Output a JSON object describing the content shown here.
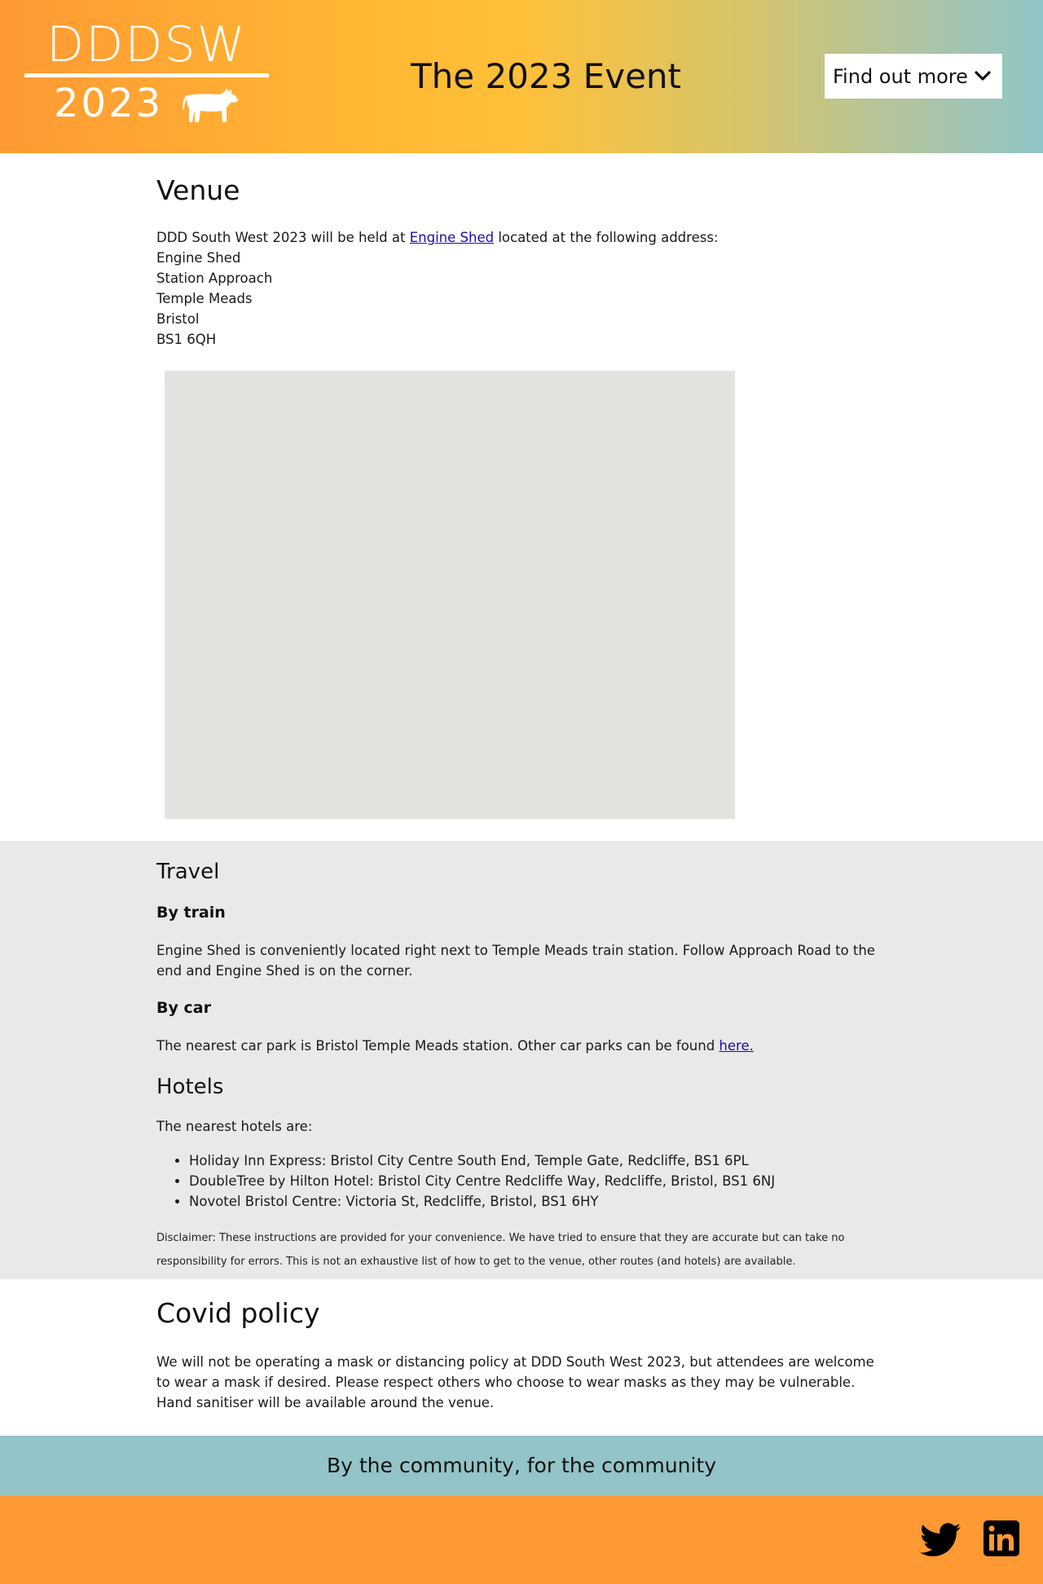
{
  "header": {
    "logo_top": "DDDSW",
    "logo_year": "2023",
    "title": "The 2023 Event",
    "find_out_more": "Find out more"
  },
  "venue": {
    "heading": "Venue",
    "intro_before": "DDD South West 2023 will be held at ",
    "intro_link": "Engine Shed",
    "intro_after": " located at the following address:",
    "address": [
      "Engine Shed",
      "Station Approach",
      "Temple Meads",
      "Bristol",
      "BS1 6QH"
    ]
  },
  "travel": {
    "heading": "Travel",
    "train_heading": "By train",
    "train_text": "Engine Shed is conveniently located right next to Temple Meads train station. Follow Approach Road to the end and Engine Shed is on the corner.",
    "car_heading": "By car",
    "car_text_before": "The nearest car park is Bristol Temple Meads station. Other car parks can be found ",
    "car_link": "here."
  },
  "hotels": {
    "heading": "Hotels",
    "intro": "The nearest hotels are:",
    "items": [
      "Holiday Inn Express: Bristol City Centre South End, Temple Gate, Redcliffe, BS1 6PL",
      "DoubleTree by Hilton Hotel: Bristol City Centre Redcliffe Way, Redcliffe, Bristol, BS1 6NJ",
      "Novotel Bristol Centre: Victoria St, Redcliffe, Bristol, BS1 6HY"
    ],
    "disclaimer": "Disclaimer: These instructions are provided for your convenience. We have tried to ensure that they are accurate but can take no responsibility for errors. This is not an exhaustive list of how to get to the venue, other routes (and hotels) are available."
  },
  "covid": {
    "heading": "Covid policy",
    "text": "We will not be operating a mask or distancing policy at DDD South West 2023, but attendees are welcome to wear a mask if desired. Please respect others who choose to wear masks as they may be vulnerable. Hand sanitiser will be available around the venue."
  },
  "community": {
    "tagline": "By the community, for the community"
  },
  "footer": {
    "icons": [
      "twitter-icon",
      "linkedin-icon"
    ]
  },
  "colors": {
    "orange": "#ff9933",
    "teal": "#93c4c8",
    "grey_band": "#e9e9e9",
    "link": "#1a0dab"
  }
}
